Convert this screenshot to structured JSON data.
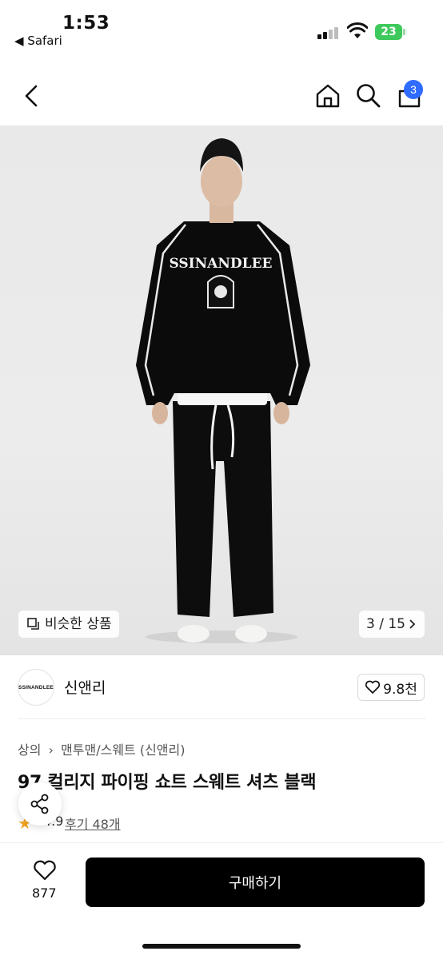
{
  "status_bar": {
    "time": "1:53",
    "back_app": "◀ Safari",
    "battery": "23"
  },
  "nav": {
    "cart_count": "3"
  },
  "hero": {
    "similar_label": "비슷한 상품",
    "page_indicator": "3 / 15",
    "print_text": "SSINANDLEE"
  },
  "brand": {
    "logo_text": "SSINANDLEE",
    "name": "신앤리",
    "likes": "9.8천"
  },
  "product": {
    "breadcrumb_root": "상의",
    "breadcrumb_sub": "맨투맨/스웨트 (신앤리)",
    "title": "97 컬리지 파이핑 쇼트 스웨트 셔츠 블랙",
    "rating": "4.9",
    "reviews": "후기 48개"
  },
  "bottom": {
    "wish_count": "877",
    "buy_label": "구매하기"
  }
}
